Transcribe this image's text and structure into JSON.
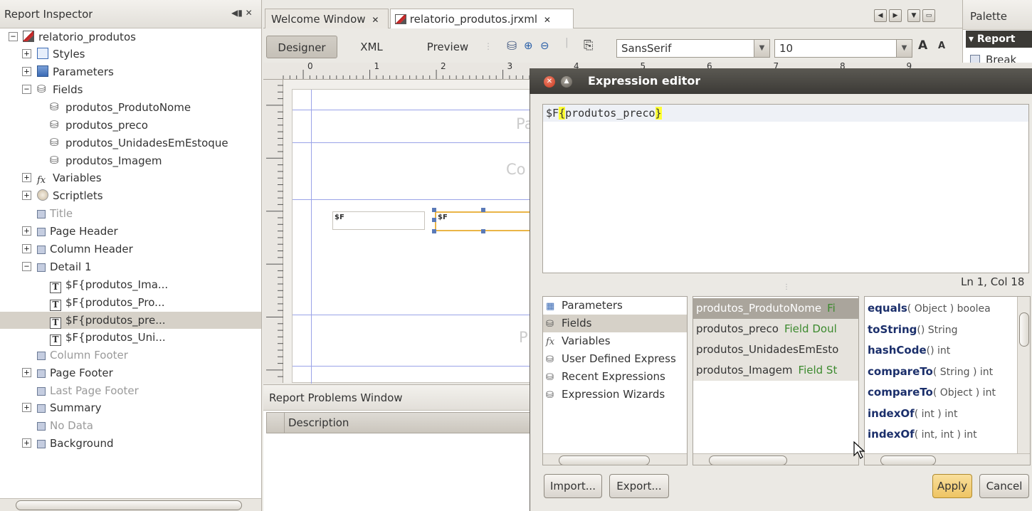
{
  "inspector": {
    "title": "Report Inspector",
    "header_controls": "◀▮ ✕",
    "items": [
      {
        "label": "relatorio_produtos",
        "toggle": "−",
        "icon": "report-icon"
      },
      {
        "label": "Styles",
        "toggle": "+",
        "icon": "styles-icon"
      },
      {
        "label": "Parameters",
        "toggle": "+",
        "icon": "parameters-icon"
      },
      {
        "label": "Fields",
        "toggle": "−",
        "icon": "fields-icon"
      },
      {
        "label": "produtos_ProdutoNome",
        "icon": "field-icon"
      },
      {
        "label": "produtos_preco",
        "icon": "field-icon"
      },
      {
        "label": "produtos_UnidadesEmEstoque",
        "icon": "field-icon"
      },
      {
        "label": "produtos_Imagem",
        "icon": "field-icon"
      },
      {
        "label": "Variables",
        "toggle": "+",
        "icon": "variables-icon"
      },
      {
        "label": "Scriptlets",
        "toggle": "+",
        "icon": "scriptlets-icon"
      },
      {
        "label": "Title",
        "icon": "band-icon",
        "dim": true
      },
      {
        "label": "Page Header",
        "toggle": "+",
        "icon": "band-icon"
      },
      {
        "label": "Column Header",
        "toggle": "+",
        "icon": "band-icon"
      },
      {
        "label": "Detail 1",
        "toggle": "−",
        "icon": "band-icon"
      },
      {
        "label": "$F{produtos_Ima...",
        "icon": "textfield-icon"
      },
      {
        "label": "$F{produtos_Pro...",
        "icon": "textfield-icon"
      },
      {
        "label": "$F{produtos_pre...",
        "icon": "textfield-icon",
        "selected": true
      },
      {
        "label": "$F{produtos_Uni...",
        "icon": "textfield-icon"
      },
      {
        "label": "Column Footer",
        "icon": "band-icon",
        "dim": true
      },
      {
        "label": "Page Footer",
        "toggle": "+",
        "icon": "band-icon"
      },
      {
        "label": "Last Page Footer",
        "icon": "band-icon",
        "dim": true
      },
      {
        "label": "Summary",
        "toggle": "+",
        "icon": "band-icon"
      },
      {
        "label": "No Data",
        "icon": "band-icon",
        "dim": true
      },
      {
        "label": "Background",
        "toggle": "+",
        "icon": "band-icon"
      }
    ]
  },
  "tabs": [
    {
      "label": "Welcome Window",
      "close": "✕"
    },
    {
      "label": "relatorio_produtos.jrxml",
      "close": "✕"
    }
  ],
  "toolbar": {
    "designer": "Designer",
    "xml": "XML",
    "preview": "Preview",
    "font_family": "SansSerif",
    "font_size": "10",
    "grow_font": "A",
    "shrink_font": "A"
  },
  "ruler_numbers": [
    "0",
    "1",
    "2",
    "3",
    "4",
    "5",
    "6",
    "7",
    "8",
    "9"
  ],
  "canvas": {
    "field1_text": "$F",
    "field2_text": "$F",
    "partial_label_1": "Pa",
    "partial_label_2": "Co",
    "partial_label_3": "P"
  },
  "palette": {
    "title": "Palette",
    "section": "▾ Report",
    "item": "Break"
  },
  "problems": {
    "title": "Report Problems Window",
    "column": "Description"
  },
  "dialog": {
    "title": "Expression editor",
    "expression_prefix": "$F",
    "expression_open": "{",
    "expression_body": "produtos_preco",
    "expression_close": "}",
    "cursor_pos": "Ln 1, Col 18",
    "categories": [
      "Parameters",
      "Fields",
      "Variables",
      "User Defined Express",
      "Recent Expressions",
      "Expression Wizards"
    ],
    "selected_category": 1,
    "fields": [
      {
        "name": "produtos_ProdutoNome",
        "type": "Fi"
      },
      {
        "name": "produtos_preco",
        "type": "Field Doul"
      },
      {
        "name": "produtos_UnidadesEmEsto",
        "type": ""
      },
      {
        "name": "produtos_Imagem",
        "type": "Field St"
      }
    ],
    "methods": [
      {
        "name": "equals",
        "args": "( Object ) boolea"
      },
      {
        "name": "toString",
        "args": "() String"
      },
      {
        "name": "hashCode",
        "args": "() int"
      },
      {
        "name": "compareTo",
        "args": "( String ) int"
      },
      {
        "name": "compareTo",
        "args": "( Object ) int"
      },
      {
        "name": "indexOf",
        "args": "( int ) int"
      },
      {
        "name": "indexOf",
        "args": "( int, int ) int"
      }
    ],
    "import_label": "Import...",
    "export_label": "Export...",
    "apply_label": "Apply",
    "cancel_label": "Cancel"
  }
}
